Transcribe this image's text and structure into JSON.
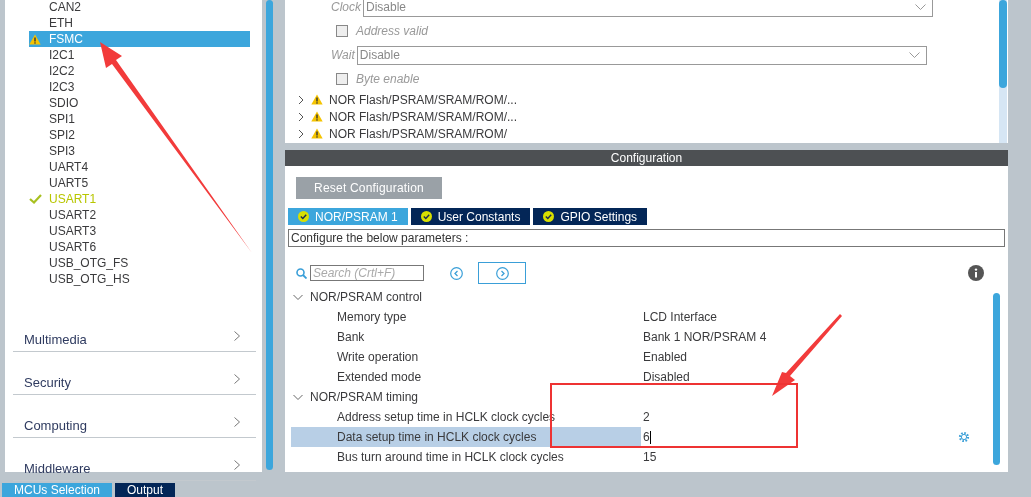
{
  "sidebar": {
    "items": [
      {
        "label": "CAN2",
        "kind": "plain",
        "selected": false
      },
      {
        "label": "ETH",
        "kind": "plain",
        "selected": false
      },
      {
        "label": "FSMC",
        "kind": "warning",
        "selected": true
      },
      {
        "label": "I2C1",
        "kind": "plain",
        "selected": false
      },
      {
        "label": "I2C2",
        "kind": "plain",
        "selected": false
      },
      {
        "label": "I2C3",
        "kind": "plain",
        "selected": false
      },
      {
        "label": "SDIO",
        "kind": "plain",
        "selected": false
      },
      {
        "label": "SPI1",
        "kind": "plain",
        "selected": false
      },
      {
        "label": "SPI2",
        "kind": "plain",
        "selected": false
      },
      {
        "label": "SPI3",
        "kind": "plain",
        "selected": false
      },
      {
        "label": "UART4",
        "kind": "plain",
        "selected": false
      },
      {
        "label": "UART5",
        "kind": "plain",
        "selected": false
      },
      {
        "label": "USART1",
        "kind": "configured",
        "selected": false
      },
      {
        "label": "USART2",
        "kind": "plain",
        "selected": false
      },
      {
        "label": "USART3",
        "kind": "plain",
        "selected": false
      },
      {
        "label": "USART6",
        "kind": "plain",
        "selected": false
      },
      {
        "label": "USB_OTG_FS",
        "kind": "plain",
        "selected": false
      },
      {
        "label": "USB_OTG_HS",
        "kind": "plain",
        "selected": false
      }
    ],
    "categories": [
      {
        "label": "Multimedia"
      },
      {
        "label": "Security"
      },
      {
        "label": "Computing"
      },
      {
        "label": "Middleware"
      }
    ]
  },
  "mode_panel": {
    "fields": [
      {
        "kind": "select",
        "label": "Clock",
        "value": "Disable"
      },
      {
        "kind": "checkbox",
        "label": "Address valid",
        "checked": false
      },
      {
        "kind": "select",
        "label": "Wait",
        "value": "Disable"
      },
      {
        "kind": "checkbox",
        "label": "Byte enable",
        "checked": false
      }
    ],
    "subsections": [
      {
        "label": "NOR Flash/PSRAM/SRAM/ROM/...",
        "expanded": false,
        "warning": true
      },
      {
        "label": "NOR Flash/PSRAM/SRAM/ROM/...",
        "expanded": false,
        "warning": true
      },
      {
        "label": "NOR Flash/PSRAM/SRAM/ROM/",
        "expanded": false,
        "warning": true
      }
    ]
  },
  "configuration": {
    "title": "Configuration",
    "reset_button": "Reset Configuration",
    "tabs": [
      {
        "label": "NOR/PSRAM 1",
        "selected": true
      },
      {
        "label": "User Constants",
        "selected": false
      },
      {
        "label": "GPIO Settings",
        "selected": false
      }
    ],
    "description": "Configure the below parameters :",
    "search": {
      "placeholder": "Search (Crtl+F)"
    },
    "groups": [
      {
        "label": "NOR/PSRAM control",
        "expanded": true,
        "rows": [
          {
            "name": "Memory type",
            "value": "LCD Interface",
            "selected": false
          },
          {
            "name": "Bank",
            "value": "Bank 1 NOR/PSRAM 4",
            "selected": false
          },
          {
            "name": "Write operation",
            "value": "Enabled",
            "selected": false
          },
          {
            "name": "Extended mode",
            "value": "Disabled",
            "selected": false
          }
        ]
      },
      {
        "label": "NOR/PSRAM timing",
        "expanded": true,
        "rows": [
          {
            "name": "Address setup time in HCLK clock cycles",
            "value": "2",
            "selected": false
          },
          {
            "name": "Data setup time in HCLK clock cycles",
            "value": "6",
            "selected": true
          },
          {
            "name": "Bus turn around time in HCLK clock cycles",
            "value": "15",
            "selected": false
          }
        ]
      }
    ]
  },
  "bottom_tabs": [
    {
      "label": "MCUs Selection",
      "selected": true
    },
    {
      "label": "Output",
      "selected": false
    }
  ]
}
